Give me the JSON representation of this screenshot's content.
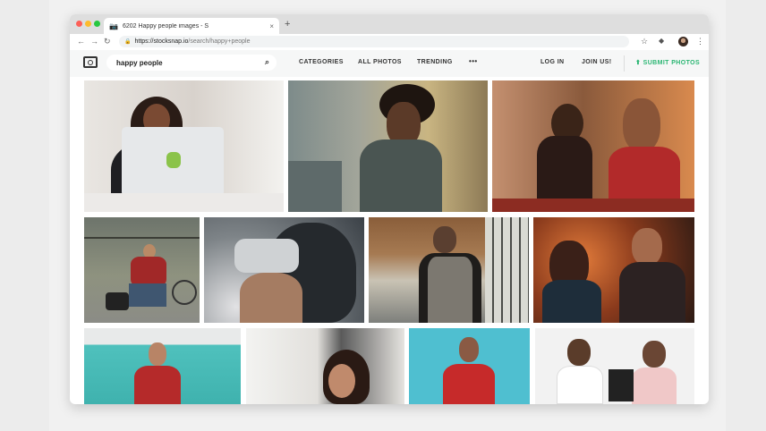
{
  "browser": {
    "tab_title": "6202 Happy people images - S",
    "tab_close": "×",
    "new_tab": "+",
    "url_host": "https://stocksnap.io",
    "url_path": "/search/happy+people",
    "nav_back": "←",
    "nav_forward": "→",
    "nav_reload": "↻",
    "bookmark_star": "☆",
    "menu_dots": "⋮"
  },
  "site": {
    "search_value": "happy people",
    "nav": {
      "categories": "CATEGORIES",
      "all_photos": "ALL PHOTOS",
      "trending": "TRENDING",
      "more": "•••",
      "login": "LOG IN",
      "join": "JOIN US!",
      "submit": "SUBMIT PHOTOS",
      "submit_icon": "⬆"
    }
  },
  "colors": {
    "accent": "#2bb673",
    "traffic_red": "#fc5f57",
    "traffic_yellow": "#fdbc2e",
    "traffic_green": "#28c840"
  },
  "photos": [
    {
      "name": "woman-laptop-photo"
    },
    {
      "name": "man-scarf-photo"
    },
    {
      "name": "couple-dinner-photo"
    },
    {
      "name": "man-bicycle-photo"
    },
    {
      "name": "vr-headset-photo"
    },
    {
      "name": "man-phone-photo"
    },
    {
      "name": "couple-restaurant-photo"
    },
    {
      "name": "man-thumbs-up-photo"
    },
    {
      "name": "woman-smiling-photo"
    },
    {
      "name": "man-cheering-photo"
    },
    {
      "name": "couple-shopping-photo"
    }
  ]
}
